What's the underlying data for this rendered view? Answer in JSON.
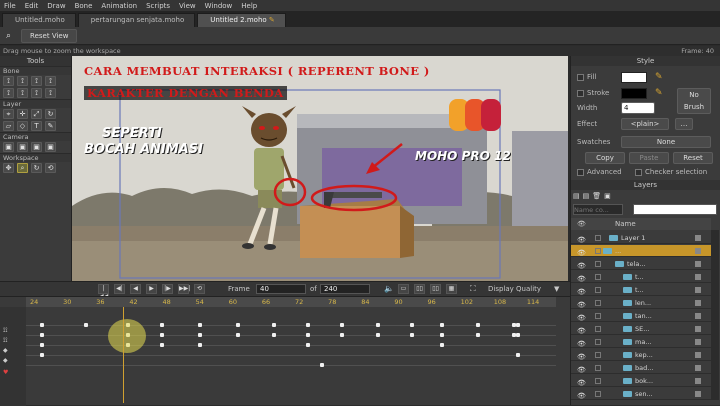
{
  "menu": [
    "File",
    "Edit",
    "Draw",
    "Bone",
    "Animation",
    "Scripts",
    "View",
    "Window",
    "Help"
  ],
  "tabs": [
    {
      "label": "Untitled.moho"
    },
    {
      "label": "pertarungan senjata.moho"
    },
    {
      "label": "Untitled 2.moho"
    }
  ],
  "toolbar": {
    "reset_view": "Reset View"
  },
  "status": {
    "hint": "Drag mouse to zoom the workspace",
    "frame": "Frame: 40"
  },
  "tools_panel": {
    "title": "Tools",
    "groups": [
      "Bone",
      "Layer",
      "Camera",
      "Workspace"
    ]
  },
  "canvas": {
    "title_line1": "CARA MEMBUAT INTERAKSI ( REPERENT BONE )",
    "title_line2": "KARAKTER DENGAN BENDA",
    "left_text_1": "SEPERTI",
    "left_text_2": "BOCAH ANIMASI",
    "right_text": "MOHO PRO 12"
  },
  "style_panel": {
    "title": "Style",
    "fill_label": "Fill",
    "stroke_label": "Stroke",
    "width_label": "Width",
    "width_value": "4",
    "no_brush": [
      "No",
      "Brush"
    ],
    "effect_label": "Effect",
    "effect_value": "<plain>",
    "swatches_label": "Swatches",
    "swatches_value": "None",
    "copy": "Copy",
    "paste": "Paste",
    "reset": "Reset",
    "advanced": "Advanced",
    "checker": "Checker selection",
    "fill_color": "#ffffff",
    "stroke_color": "#000000"
  },
  "layers_panel": {
    "title": "Layers",
    "name_filter_placeholder": "Name co...",
    "column_name": "Name",
    "rows": [
      {
        "name": "Layer 1"
      },
      {
        "name": "..."
      },
      {
        "name": "tela..."
      },
      {
        "name": "t..."
      },
      {
        "name": "t..."
      },
      {
        "name": "len..."
      },
      {
        "name": "tan..."
      },
      {
        "name": "SE..."
      },
      {
        "name": "ma..."
      },
      {
        "name": "kep..."
      },
      {
        "name": "bad..."
      },
      {
        "name": "bok..."
      },
      {
        "name": "sen..."
      }
    ]
  },
  "playbar": {
    "frame_label": "Frame",
    "frame_value": "40",
    "of_label": "of",
    "total_value": "240",
    "display_quality": "Display Quality"
  },
  "timeline": {
    "ticks": [
      "24",
      "30",
      "36",
      "42",
      "48",
      "54",
      "60",
      "66",
      "72",
      "78",
      "84",
      "90",
      "96",
      "102",
      "108",
      "114"
    ]
  },
  "colors": {
    "accent": "#d6a430",
    "layer_selected": "#c7962a",
    "title_red": "#d11a1a"
  }
}
